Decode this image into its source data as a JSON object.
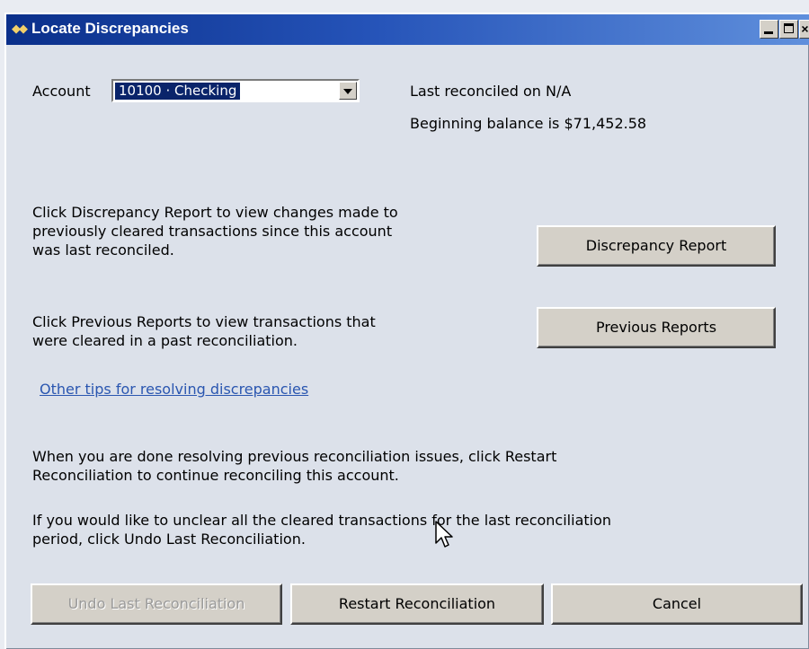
{
  "window": {
    "title": "Locate Discrepancies"
  },
  "account": {
    "label": "Account",
    "selected": "10100 · Checking"
  },
  "status": {
    "last_reconciled": "Last reconciled on N/A",
    "beginning_balance": "Beginning balance is $71,452.58"
  },
  "discrepancy": {
    "description": "Click Discrepancy Report to view changes made to\npreviously cleared transactions since this account\nwas last reconciled.",
    "button_label": "Discrepancy Report"
  },
  "previous": {
    "description": "Click Previous Reports to view transactions that\nwere cleared in a past reconciliation.",
    "button_label": "Previous Reports"
  },
  "tips_link": "Other tips for resolving discrepancies",
  "restart_info": "When you are done resolving previous reconciliation issues, click Restart\nReconciliation to continue reconciling this account.",
  "undo_info": "If you would like to unclear all the cleared transactions for the last reconciliation\nperiod, click Undo Last Reconciliation.",
  "buttons": {
    "undo": "Undo Last Reconciliation",
    "restart": "Restart Reconciliation",
    "cancel": "Cancel"
  },
  "icons": {
    "app": "quickbooks-app-icon",
    "minimize": "minimize-icon",
    "maximize": "maximize-icon",
    "close": "close-icon",
    "dropdown": "chevron-down-icon",
    "cursor": "mouse-pointer-icon"
  },
  "colors": {
    "titlebar": "#0a2f8a",
    "link": "#2a56b0",
    "selection": "#0a246a"
  }
}
